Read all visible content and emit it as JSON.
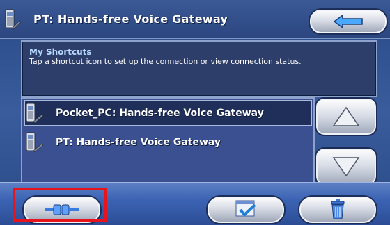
{
  "window": {
    "title": "PT: Hands-free Voice Gateway"
  },
  "info": {
    "heading": "My Shortcuts",
    "text": "Tap a shortcut icon to set up the connection or view connection status."
  },
  "shortcuts": [
    {
      "label": "Pocket_PC: Hands-free Voice Gateway",
      "icon": "phone-icon"
    },
    {
      "label": "PT: Hands-free Voice Gateway",
      "icon": "phone-icon"
    }
  ],
  "colors": {
    "highlight": "#e8141c",
    "accent_arrow": "#4aa8ff"
  }
}
